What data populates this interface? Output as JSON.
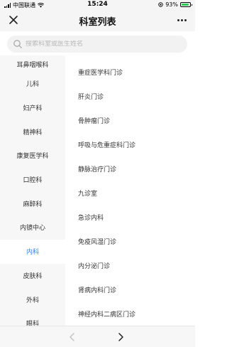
{
  "status_bar": {
    "carrier": "中国联通",
    "time": "15:24",
    "battery_percent": "93%",
    "battery_level": 0.93,
    "icons": [
      "signal-icon",
      "wifi-icon",
      "location-icon",
      "battery-icon"
    ]
  },
  "nav": {
    "title": "科室列表",
    "close_icon": "close-icon",
    "more_icon": "more-icon"
  },
  "search": {
    "placeholder": "搜索科室或医生姓名",
    "value": ""
  },
  "sidebar": {
    "active_color": "#2f7ff4",
    "items": [
      {
        "label": "耳鼻咽喉科"
      },
      {
        "label": "儿科"
      },
      {
        "label": "妇产科"
      },
      {
        "label": "精神科"
      },
      {
        "label": "康复医学科"
      },
      {
        "label": "口腔科"
      },
      {
        "label": "麻醉科"
      },
      {
        "label": "内镜中心"
      },
      {
        "label": "内科"
      },
      {
        "label": "皮肤科"
      },
      {
        "label": "外科"
      },
      {
        "label": "眼科"
      }
    ],
    "active_index": 8
  },
  "clinics": {
    "items": [
      {
        "label": "重症医学科门诊"
      },
      {
        "label": "肝炎门诊"
      },
      {
        "label": "骨肿瘤门诊"
      },
      {
        "label": "呼吸与危重症科门诊"
      },
      {
        "label": "静脉治疗门诊"
      },
      {
        "label": "九诊室"
      },
      {
        "label": "急诊内科"
      },
      {
        "label": "免疫风湿门诊"
      },
      {
        "label": "内分泌门诊"
      },
      {
        "label": "肾病内科门诊"
      },
      {
        "label": "神经内科二病区门诊"
      }
    ]
  },
  "bottom": {
    "back_icon": "chevron-left-icon",
    "forward_icon": "chevron-right-icon"
  }
}
